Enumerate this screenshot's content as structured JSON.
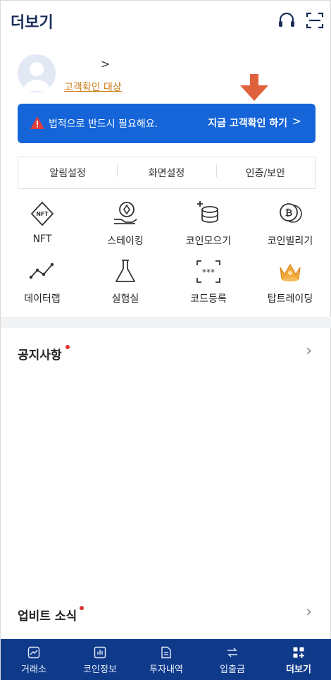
{
  "header": {
    "title": "더보기"
  },
  "profile": {
    "name_chevron": ">",
    "verify_link": "고객확인 대상"
  },
  "banner": {
    "message": "법적으로 반드시 필요해요.",
    "cta": "지금 고객확인 하기",
    "cta_chevron": ">"
  },
  "settings": {
    "items": [
      "알림설정",
      "화면설정",
      "인증/보안"
    ]
  },
  "grid": {
    "items": [
      {
        "label": "NFT",
        "icon": "nft-icon"
      },
      {
        "label": "스테이킹",
        "icon": "staking-icon"
      },
      {
        "label": "코인모으기",
        "icon": "coin-stack-icon"
      },
      {
        "label": "코인빌리기",
        "icon": "bitcoin-lend-icon"
      },
      {
        "label": "데이터랩",
        "icon": "chart-line-icon"
      },
      {
        "label": "실험실",
        "icon": "flask-icon"
      },
      {
        "label": "코드등록",
        "icon": "code-register-icon"
      },
      {
        "label": "탑트레이딩",
        "icon": "crown-icon"
      }
    ]
  },
  "sections": {
    "notice": "공지사항",
    "news": "업비트 소식"
  },
  "bottom_nav": {
    "tabs": [
      {
        "label": "거래소",
        "icon": "exchange-icon"
      },
      {
        "label": "코인정보",
        "icon": "coin-info-icon"
      },
      {
        "label": "투자내역",
        "icon": "history-icon"
      },
      {
        "label": "입출금",
        "icon": "transfer-icon"
      },
      {
        "label": "더보기",
        "icon": "more-icon",
        "active": true
      }
    ]
  },
  "colors": {
    "primary": "#1565d8",
    "nav_bg": "#0f3a8a",
    "link": "#c77b12",
    "annotation_arrow": "#e0623c",
    "badge": "#d33"
  }
}
